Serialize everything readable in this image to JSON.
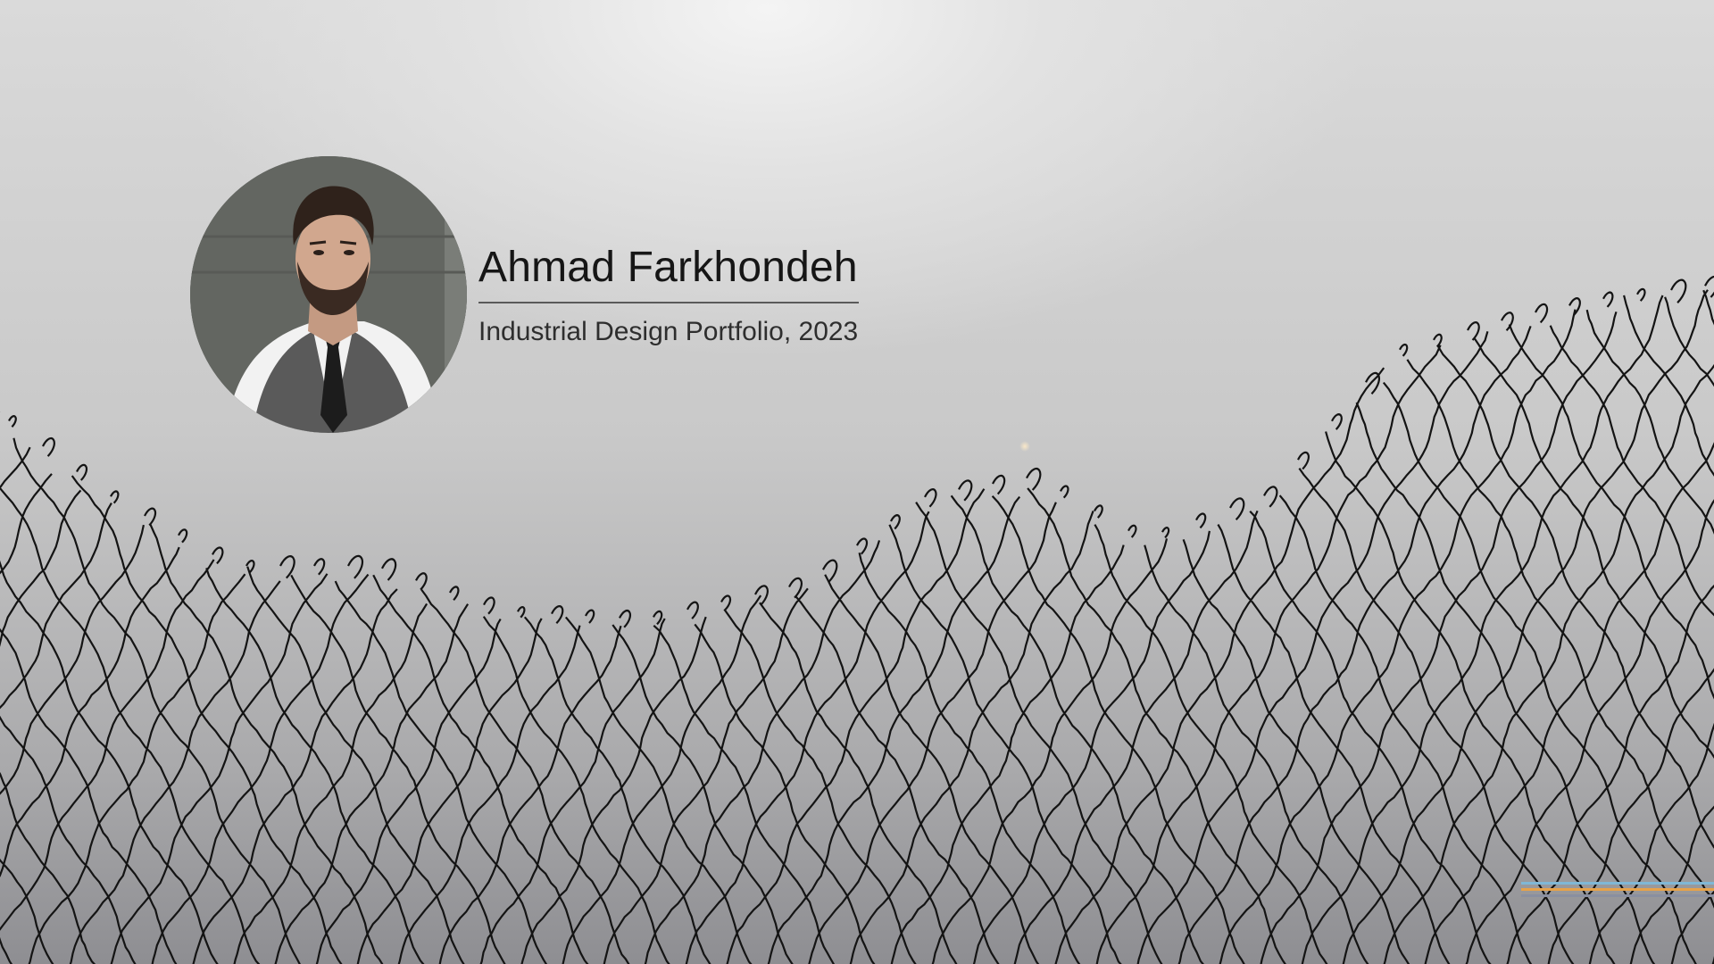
{
  "profile": {
    "name": "Ahmad Farkhondeh",
    "subtitle": "Industrial Design Portfolio, 2023",
    "photo_icon": "person-portrait"
  },
  "decor": {
    "background_icon": "broken-chain-link-fence",
    "accent_colors": [
      "#7fb7d6",
      "#e6a24a",
      "#8a8fa0"
    ]
  }
}
